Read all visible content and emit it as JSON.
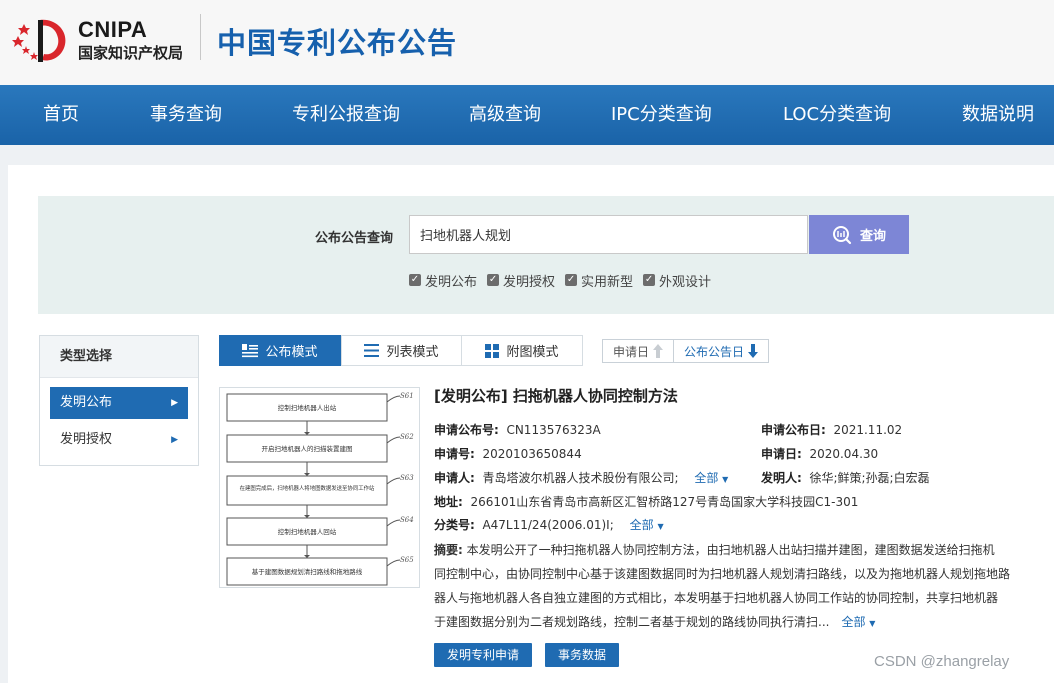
{
  "header": {
    "logo_en": "CNIPA",
    "logo_cn": "国家知识产权局",
    "site_title": "中国专利公布公告"
  },
  "nav": {
    "items": [
      "首页",
      "事务查询",
      "专利公报查询",
      "高级查询",
      "IPC分类查询",
      "LOC分类查询",
      "数据说明"
    ]
  },
  "search": {
    "label": "公布公告查询",
    "value": "扫地机器人规划",
    "button": "查询",
    "checkboxes": [
      {
        "label": "发明公布",
        "checked": true
      },
      {
        "label": "发明授权",
        "checked": true
      },
      {
        "label": "实用新型",
        "checked": true
      },
      {
        "label": "外观设计",
        "checked": true
      }
    ]
  },
  "sidebar": {
    "title": "类型选择",
    "items": [
      {
        "label": "发明公布",
        "active": true
      },
      {
        "label": "发明授权",
        "active": false
      }
    ]
  },
  "modes": {
    "tabs": [
      {
        "label": "公布模式",
        "icon": "list-detail-icon",
        "active": true
      },
      {
        "label": "列表模式",
        "icon": "list-icon",
        "active": false
      },
      {
        "label": "附图模式",
        "icon": "grid-icon",
        "active": false
      }
    ],
    "sort": [
      {
        "label": "申请日",
        "icon": "arrow-up-icon"
      },
      {
        "label": "公布公告日",
        "icon": "arrow-down-icon"
      }
    ]
  },
  "result": {
    "title": "[发明公布] 扫拖机器人协同控制方法",
    "pub_no_label": "申请公布号:",
    "pub_no": "CN113576323A",
    "pub_date_label": "申请公布日:",
    "pub_date": "2021.11.02",
    "app_no_label": "申请号:",
    "app_no": "2020103650844",
    "app_date_label": "申请日:",
    "app_date": "2020.04.30",
    "applicant_label": "申请人:",
    "applicant": "青岛塔波尔机器人技术股份有限公司;",
    "all_label": "全部",
    "inventor_label": "发明人:",
    "inventor": "徐华;鲜策;孙磊;白宏磊",
    "address_label": "地址:",
    "address": "266101山东省青岛市高新区汇智桥路127号青岛国家大学科技园C1-301",
    "class_label": "分类号:",
    "class_value": "A47L11/24(2006.01)I;",
    "abstract_label": "摘要:",
    "abstract_lines": [
      "本发明公开了一种扫拖机器人协同控制方法，由扫地机器人出站扫描并建图，建图数据发送给扫拖机",
      "同控制中心，由协同控制中心基于该建图数据同时为扫地机器人规划清扫路线，以及为拖地机器人规划拖地路",
      "器人与拖地机器人各自独立建图的方式相比，本发明基于扫地机器人协同工作站的协同控制，共享扫地机器",
      "于建图数据分别为二者规划路线，控制二者基于规划的路线协同执行清扫..."
    ],
    "buttons": [
      "发明专利申请",
      "事务数据"
    ],
    "flowchart_steps": [
      {
        "text": "控制扫地机器人出站",
        "tag": "S61"
      },
      {
        "text": "开启扫地机器人的扫描装置建图",
        "tag": "S62"
      },
      {
        "text": "在建图完成后，扫地机器人将地图数据发送至协同工作站",
        "tag": "S63"
      },
      {
        "text": "控制扫地机器人回站",
        "tag": "S64"
      },
      {
        "text": "基于建图数据规划清扫路线和拖地路线",
        "tag": "S65"
      }
    ]
  },
  "watermark": "CSDN @zhangrelay",
  "colors": {
    "brand_blue": "#1f6bb2",
    "title_blue": "#1660ad",
    "search_button": "#7d86d6",
    "panel_bg": "#e7f0ef"
  }
}
